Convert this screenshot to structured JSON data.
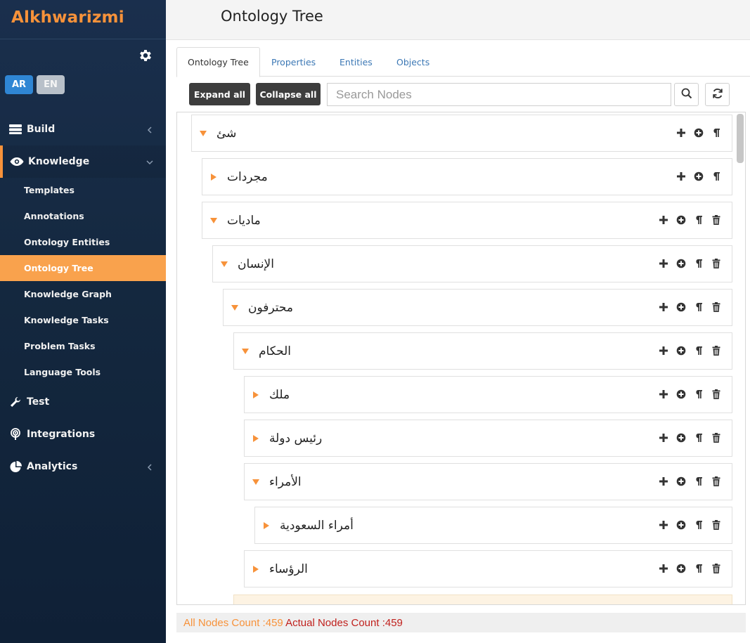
{
  "app": {
    "brand": "Alkhwarizmi"
  },
  "lang": {
    "ar": "AR",
    "en": "EN"
  },
  "sidebar": {
    "menu": [
      {
        "label": "Build",
        "icon": "server-icon"
      },
      {
        "label": "Knowledge",
        "icon": "eye-icon"
      },
      {
        "label": "Test",
        "icon": "wrench-icon"
      },
      {
        "label": "Integrations",
        "icon": "broadcast-icon"
      },
      {
        "label": "Analytics",
        "icon": "pie-chart-icon"
      }
    ],
    "knowledge_sub": [
      {
        "label": "Templates"
      },
      {
        "label": "Annotations"
      },
      {
        "label": "Ontology Entities"
      },
      {
        "label": "Ontology Tree"
      },
      {
        "label": "Knowledge Graph"
      },
      {
        "label": "Knowledge Tasks"
      },
      {
        "label": "Problem Tasks"
      },
      {
        "label": "Language Tools"
      }
    ]
  },
  "header": {
    "title": "Ontology Tree"
  },
  "tabs": [
    {
      "label": "Ontology Tree"
    },
    {
      "label": "Properties"
    },
    {
      "label": "Entities"
    },
    {
      "label": "Objects"
    }
  ],
  "toolbar": {
    "expand_all": "Expand all",
    "collapse_all": "Collapse all",
    "search_placeholder": "Search Nodes",
    "search_value": ""
  },
  "tree": [
    {
      "label": "شئ",
      "expanded": true
    },
    {
      "label": "مجردات",
      "expanded": false
    },
    {
      "label": "ماديات",
      "expanded": true
    },
    {
      "label": "الإنسان",
      "expanded": true
    },
    {
      "label": "محترفون",
      "expanded": true
    },
    {
      "label": "الحكام",
      "expanded": true
    },
    {
      "label": "ملك",
      "expanded": false
    },
    {
      "label": "رئيس دولة",
      "expanded": false
    },
    {
      "label": "الأمراء",
      "expanded": true
    },
    {
      "label": "أمراء السعودية",
      "expanded": false
    },
    {
      "label": "الرؤساء",
      "expanded": false
    }
  ],
  "footer": {
    "all_nodes": "All Nodes Count :459",
    "actual_nodes": "Actual Nodes Count :459"
  },
  "colors": {
    "accent": "#f7923a",
    "sidebar_bg": "#14283f",
    "active_lang": "#2f86d4",
    "link": "#3c78b5",
    "danger_text": "#c0211d"
  }
}
